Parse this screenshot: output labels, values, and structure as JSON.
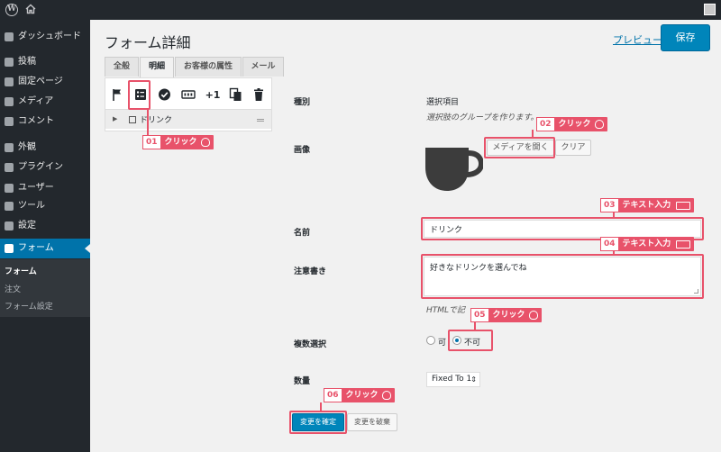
{
  "adminbar": {
    "wp_logo": "W",
    "home_icon": "home-icon",
    "avatar_icon": "avatar-icon"
  },
  "sidebar": {
    "items": [
      {
        "label": "ダッシュボード",
        "icon": "dashboard-icon"
      },
      {
        "label": "投稿",
        "icon": "pin-icon"
      },
      {
        "label": "固定ページ",
        "icon": "page-icon"
      },
      {
        "label": "メディア",
        "icon": "media-icon"
      },
      {
        "label": "コメント",
        "icon": "comment-icon"
      },
      {
        "label": "外観",
        "icon": "brush-icon"
      },
      {
        "label": "プラグイン",
        "icon": "plugin-icon"
      },
      {
        "label": "ユーザー",
        "icon": "user-icon"
      },
      {
        "label": "ツール",
        "icon": "wrench-icon"
      },
      {
        "label": "設定",
        "icon": "settings-icon"
      },
      {
        "label": "フォーム",
        "icon": "check-icon"
      }
    ],
    "submenu": [
      "フォーム",
      "注文",
      "フォーム設定"
    ]
  },
  "page": {
    "title": "フォーム詳細",
    "preview": "プレビュー",
    "save": "保存"
  },
  "tabs": [
    "全般",
    "明細",
    "お客様の属性",
    "メール"
  ],
  "toolbar": {
    "plus_one": "+1",
    "icons": [
      "flag-icon",
      "list-item-icon",
      "check-circle-icon",
      "counter-icon",
      "plus-one-icon",
      "copy-icon",
      "trash-icon"
    ]
  },
  "tree": {
    "item_label": "ドリンク"
  },
  "form": {
    "type_label": "種別",
    "type_value": "選択項目",
    "type_desc": "選択肢のグループを作ります。",
    "image_label": "画像",
    "open_media": "メディアを開く",
    "clear": "クリア",
    "name_label": "名前",
    "name_value": "ドリンク",
    "note_label": "注意書き",
    "note_value": "好きなドリンクを選んでね",
    "note_hint": "HTMLで記",
    "multi_label": "複数選択",
    "radio_yes": "可",
    "radio_no": "不可",
    "multi_selected": "不可",
    "qty_label": "数量",
    "qty_value": "Fixed To 1",
    "confirm": "変更を確定",
    "discard": "変更を破棄"
  },
  "annotations": [
    {
      "num": "01",
      "text": "クリック",
      "kind": "mouse"
    },
    {
      "num": "02",
      "text": "クリック",
      "kind": "mouse"
    },
    {
      "num": "03",
      "text": "テキスト入力",
      "kind": "keyboard"
    },
    {
      "num": "04",
      "text": "テキスト入力",
      "kind": "keyboard"
    },
    {
      "num": "05",
      "text": "クリック",
      "kind": "mouse"
    },
    {
      "num": "06",
      "text": "クリック",
      "kind": "mouse"
    }
  ],
  "colors": {
    "admin_dark": "#23282d",
    "accent": "#0073aa",
    "button": "#0085ba",
    "annotation": "#e8526a"
  }
}
